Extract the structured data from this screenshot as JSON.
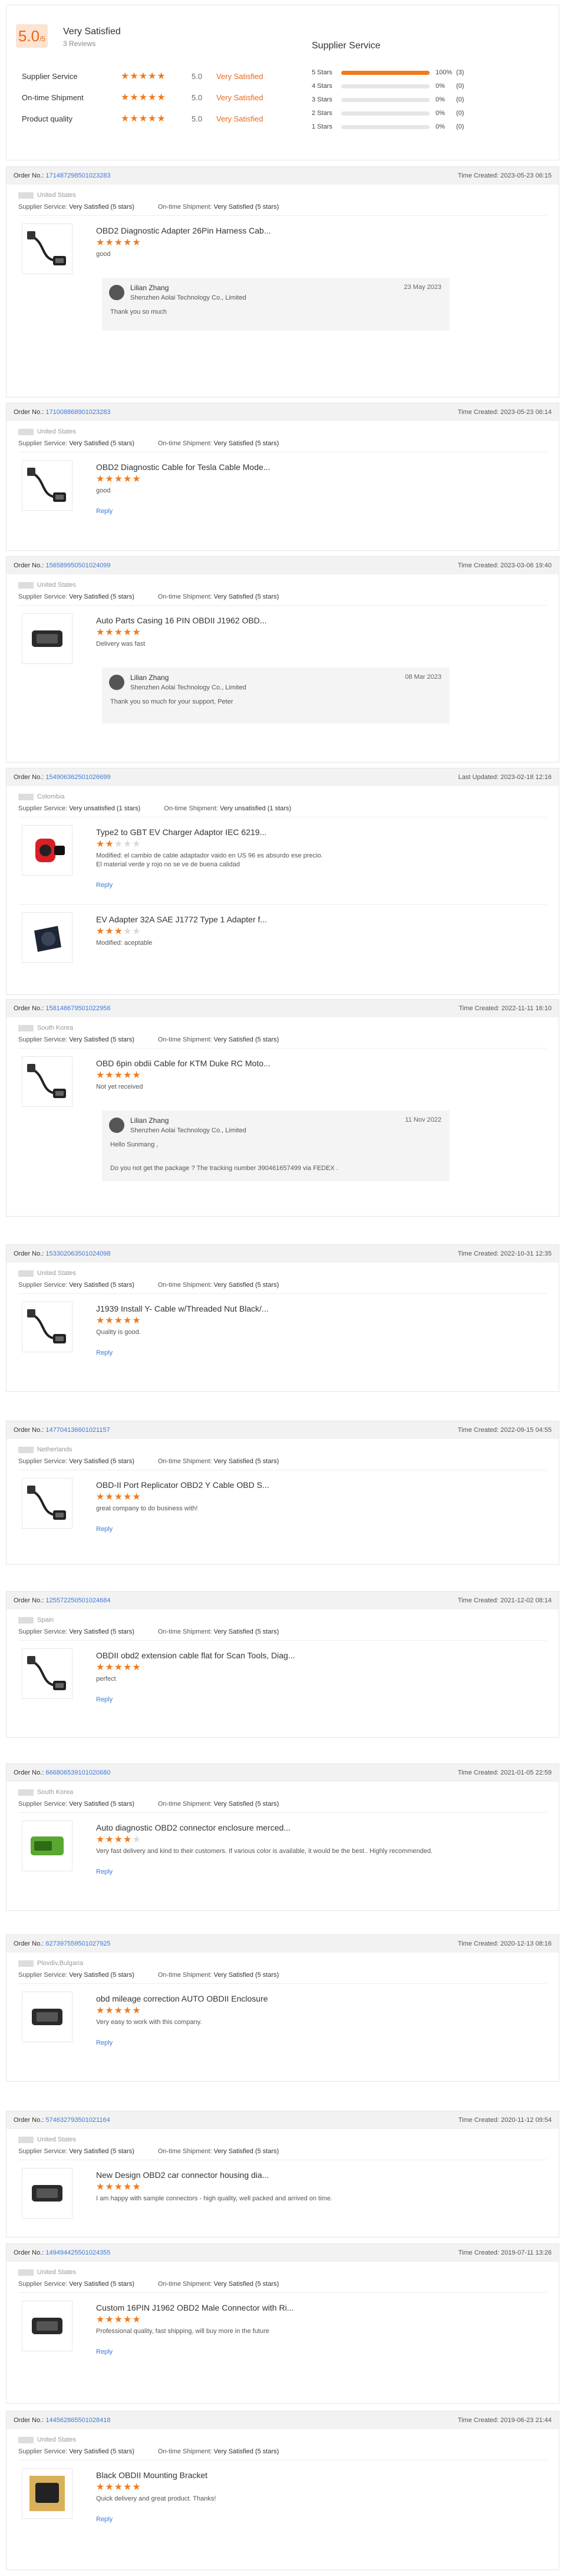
{
  "summary": {
    "score": "5.0",
    "score_suffix": "/5",
    "title": "Very Satisfied",
    "reviews": "3 Reviews",
    "rows": [
      {
        "label": "Supplier Service",
        "value": "5.0",
        "text": "Very Satisfied",
        "stars": 5
      },
      {
        "label": "On-time Shipment",
        "value": "5.0",
        "text": "Very Satisfied",
        "stars": 5
      },
      {
        "label": "Product quality",
        "value": "5.0",
        "text": "Very Satisfied",
        "stars": 5
      }
    ],
    "dist_title": "Supplier Service",
    "dist": [
      {
        "label": "5 Stars",
        "pct": "100%",
        "count": "(3)",
        "fill": 1.0
      },
      {
        "label": "4 Stars",
        "pct": "0%",
        "count": "(0)",
        "fill": 0
      },
      {
        "label": "3 Stars",
        "pct": "0%",
        "count": "(0)",
        "fill": 0
      },
      {
        "label": "2 Stars",
        "pct": "0%",
        "count": "(0)",
        "fill": 0
      },
      {
        "label": "1 Stars",
        "pct": "0%",
        "count": "(0)",
        "fill": 0
      }
    ]
  },
  "labels": {
    "order_no": "Order No.:",
    "supplier_service": "Supplier Service:",
    "ontime": "On-time Shipment:",
    "reply": "Reply"
  },
  "orders": [
    {
      "no": "171487298501023283",
      "time": "Time Created: 2023-05-23 06:15",
      "country": "United States",
      "service": "Very Satisfied (5 stars)",
      "shipment": "Very Satisfied (5 stars)",
      "items": [
        {
          "name": "OBD2 Diagnostic Adapter 26Pin Harness Cab...",
          "stars": 5,
          "text": [
            "good"
          ],
          "reply_link": false
        }
      ],
      "reply": {
        "name": "Lilian Zhang",
        "company": "Shenzhen Aolai Technology Co., Limited",
        "date": "23 May 2023",
        "messages": [
          "Thank you so much"
        ]
      }
    },
    {
      "no": "171008868901023283",
      "time": "Time Created: 2023-05-23 06:14",
      "country": "United States",
      "service": "Very Satisfied (5 stars)",
      "shipment": "Very Satisfied (5 stars)",
      "items": [
        {
          "name": "OBD2 Diagnostic Cable for Tesla Cable Mode...",
          "stars": 5,
          "text": [
            "good"
          ],
          "reply_link": true
        }
      ]
    },
    {
      "no": "156589950501024099",
      "time": "Time Created: 2023-03-06 19:40",
      "country": "United States",
      "service": "Very Satisfied (5 stars)",
      "shipment": "Very Satisfied (5 stars)",
      "items": [
        {
          "name": "Auto Parts Casing 16 PIN OBDII J1962 OBD...",
          "stars": 5,
          "text": [
            "Delivery was fast"
          ],
          "reply_link": false
        }
      ],
      "reply": {
        "name": "Lilian Zhang",
        "company": "Shenzhen Aolai Technology Co., Limited",
        "date": "08 Mar 2023",
        "messages": [
          "Thank you so much for your support, Peter"
        ]
      }
    },
    {
      "no": "154906362501026699",
      "time": "Last Updated: 2023-02-18 12:16",
      "country": "Colombia",
      "service": "Very unsatisfied (1 stars)",
      "shipment": "Very unsatisfied (1 stars)",
      "items": [
        {
          "name": "Type2 to GBT EV Charger Adaptor IEC 6219...",
          "stars": 2,
          "text": [
            "Modified: el cambio de cable adaptador vaido en US 96 es absurdo ese precio.",
            "El material verde y rojo no se ve de buena calidad"
          ],
          "reply_link": true
        },
        {
          "name": "EV Adapter 32A SAE J1772 Type 1 Adapter f...",
          "stars": 3,
          "text": [
            "Modified: aceptable"
          ],
          "reply_link": false
        }
      ]
    },
    {
      "no": "158148679501022956",
      "time": "Time Created: 2022-11-11 16:10",
      "country": "South Korea",
      "service": "Very Satisfied (5 stars)",
      "shipment": "Very Satisfied (5 stars)",
      "items": [
        {
          "name": "OBD 6pin obdii Cable for KTM Duke RC Moto...",
          "stars": 5,
          "text": [
            "Not yet received"
          ],
          "reply_link": false
        }
      ],
      "reply": {
        "name": "Lilian Zhang",
        "company": "Shenzhen Aolai Technology Co., Limited",
        "date": "11 Nov 2022",
        "messages": [
          "Hello Sunmang ,",
          "Do you not get the package ? The tracking number 390461657499 via FEDEX ."
        ]
      }
    },
    {
      "no": "153302063501024098",
      "time": "Time Created: 2022-10-31 12:35",
      "country": "United States",
      "service": "Very Satisfied (5 stars)",
      "shipment": "Very Satisfied (5 stars)",
      "items": [
        {
          "name": "J1939 Install Y- Cable w/Threaded Nut Black/...",
          "stars": 5,
          "text": [
            "Quality is good."
          ],
          "reply_link": true
        }
      ]
    },
    {
      "no": "147704136601021157",
      "time": "Time Created: 2022-09-15 04:55",
      "country": "Netherlands",
      "service": "Very Satisfied (5 stars)",
      "shipment": "Very Satisfied (5 stars)",
      "items": [
        {
          "name": "OBD-II Port Replicator OBD2 Y Cable OBD S...",
          "stars": 5,
          "text": [
            "great company to do business with!"
          ],
          "reply_link": true
        }
      ]
    },
    {
      "no": "125572250501024684",
      "time": "Time Created: 2021-12-02 08:14",
      "country": "Spain",
      "service": "Very Satisfied (5 stars)",
      "shipment": "Very Satisfied (5 stars)",
      "items": [
        {
          "name": "OBDII obd2 extension cable flat for Scan Tools, Diag...",
          "stars": 5,
          "text": [
            "perfect"
          ],
          "reply_link": true
        }
      ]
    },
    {
      "no": "666806539101020680",
      "time": "Time Created: 2021-01-05 22:59",
      "country": "South Korea",
      "service": "Very Satisfied (5 stars)",
      "shipment": "Very Satisfied (5 stars)",
      "items": [
        {
          "name": "Auto diagnostic OBD2 connector enclosure merced...",
          "stars": 4,
          "text": [
            "Very fast delivery and kind to their customers. If various color is available, it would be the best.. Highly recommended."
          ],
          "reply_link": true
        }
      ]
    },
    {
      "no": "627397559501027925",
      "time": "Time Created: 2020-12-13 08:16",
      "country": "Plovdiv,Bulgaria",
      "service": "Very Satisfied (5 stars)",
      "shipment": "Very Satisfied (5 stars)",
      "items": [
        {
          "name": "obd mileage correction AUTO OBDII Enclosure",
          "stars": 5,
          "text": [
            "Very easy to work with this company."
          ],
          "reply_link": true
        }
      ]
    },
    {
      "no": "574632793501021164",
      "time": "Time Created: 2020-11-12 09:54",
      "country": "United States",
      "service": "Very Satisfied (5 stars)",
      "shipment": "Very Satisfied (5 stars)",
      "items": [
        {
          "name": "New Design OBD2 car connector housing dia...",
          "stars": 5,
          "text": [
            "I am happy with sample connectors - high quality, well packed and arrived on time."
          ],
          "reply_link": false
        }
      ]
    },
    {
      "no": "149494425501024355",
      "time": "Time Created: 2019-07-11 13:26",
      "country": "United States",
      "service": "Very Satisfied (5 stars)",
      "shipment": "Very Satisfied (5 stars)",
      "items": [
        {
          "name": "Custom 16PIN J1962 OBD2 Male Connector with Ri...",
          "stars": 5,
          "text": [
            "Professional quality, fast shipping, will buy more in the future"
          ],
          "reply_link": true
        }
      ]
    },
    {
      "no": "144562865501028418",
      "time": "Time Created: 2019-06-23 21:44",
      "country": "United States",
      "service": "Very Satisfied (5 stars)",
      "shipment": "Very Satisfied (5 stars)",
      "items": [
        {
          "name": "Black OBDII Mounting Bracket",
          "stars": 5,
          "text": [
            "Quick delivery and great product. Thanks!"
          ],
          "reply_link": true
        }
      ]
    }
  ]
}
